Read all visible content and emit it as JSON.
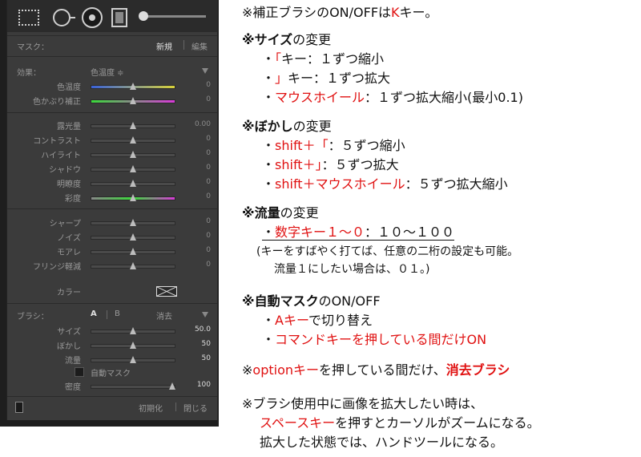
{
  "panel": {
    "mask_label": "マスク：",
    "mask_new": "新規",
    "mask_edit": "編集",
    "effect_label": "効果：",
    "effect_value": "色温度 ≑",
    "sliders": [
      {
        "label": "色温度",
        "value": "0",
        "pos": 0.5,
        "gradient": "linear-gradient(90deg,#3a62d8,#d8d23a)"
      },
      {
        "label": "色かぶり補正",
        "value": "0",
        "pos": 0.5,
        "gradient": "linear-gradient(90deg,#3ad83a,#d83ad8)"
      },
      {
        "label": "露光量",
        "value": "0.00",
        "pos": 0.5
      },
      {
        "label": "コントラスト",
        "value": "0",
        "pos": 0.5
      },
      {
        "label": "ハイライト",
        "value": "0",
        "pos": 0.5
      },
      {
        "label": "シャドウ",
        "value": "0",
        "pos": 0.5
      },
      {
        "label": "明瞭度",
        "value": "0",
        "pos": 0.5
      },
      {
        "label": "彩度",
        "value": "0",
        "pos": 0.5,
        "gradient": "linear-gradient(90deg,#888,#3ad83a,#d83ad8)"
      },
      {
        "label": "シャープ",
        "value": "0",
        "pos": 0.5
      },
      {
        "label": "ノイズ",
        "value": "0",
        "pos": 0.5
      },
      {
        "label": "モアレ",
        "value": "0",
        "pos": 0.5
      },
      {
        "label": "フリンジ軽減",
        "value": "0",
        "pos": 0.5
      }
    ],
    "color_label": "カラー",
    "brush_label": "ブラシ：",
    "brush_a": "A",
    "brush_b": "B",
    "brush_erase": "消去",
    "brush_sliders": [
      {
        "label": "サイズ",
        "value": "50.0",
        "pos": 0.5
      },
      {
        "label": "ぼかし",
        "value": "50",
        "pos": 0.5
      },
      {
        "label": "流量",
        "value": "50",
        "pos": 0.5
      }
    ],
    "auto_mask": "自動マスク",
    "density_label": "密度",
    "density_value": "100",
    "density_pos": 0.97,
    "reset": "初期化",
    "close": "閉じる"
  },
  "notes": {
    "l1a": "※補正ブラシのON/OFFは",
    "l1b": "K",
    "l1c": "キー。",
    "size_title_a": "※",
    "size_title_b": "サイズ",
    "size_title_c": "の変更",
    "size1a": "・",
    "size1b": "「",
    "size1c": "キー：１ずつ縮小",
    "size2a": "・",
    "size2b": "」",
    "size2c": "キー：１ずつ拡大",
    "size3a": "・",
    "size3b": "マウスホイール",
    "size3c": "：１ずつ拡大縮小(最小0.1)",
    "blur_title_a": "※",
    "blur_title_b": "ぼかし",
    "blur_title_c": "の変更",
    "blur1a": "・",
    "blur1b": "shift＋「",
    "blur1c": "：５ずつ縮小",
    "blur2a": "・",
    "blur2b": "shift＋」",
    "blur2c": "：５ずつ拡大",
    "blur3a": "・",
    "blur3b": "shift＋マウスホイール",
    "blur3c": "：５ずつ拡大縮小",
    "flow_title_a": "※",
    "flow_title_b": "流量",
    "flow_title_c": "の変更",
    "flow1a": "・",
    "flow1b": "数字キー１〜０",
    "flow1c": "：１０〜１００",
    "flow2": "(キーをすばやく打てば、任意の二桁の設定も可能。",
    "flow3": "流量１にしたい場合は、０１。)",
    "auto_title_a": "※",
    "auto_title_b": "自動マスク",
    "auto_title_c": "のON/OFF",
    "auto1a": "・",
    "auto1b": "Aキー",
    "auto1c": "で切り替え",
    "auto2a": "・",
    "auto2b": "コマンドキーを押している間だけON",
    "opt_a": "※",
    "opt_b": "optionキー",
    "opt_c": "を押している間だけ、",
    "opt_d": "消去ブラシ",
    "zoom1": "※ブラシ使用中に画像を拡大したい時は、",
    "zoom2a": "スペースキー",
    "zoom2b": "を押すとカーソルがズームになる。",
    "zoom3": "拡大した状態では、ハンドツールになる。"
  }
}
